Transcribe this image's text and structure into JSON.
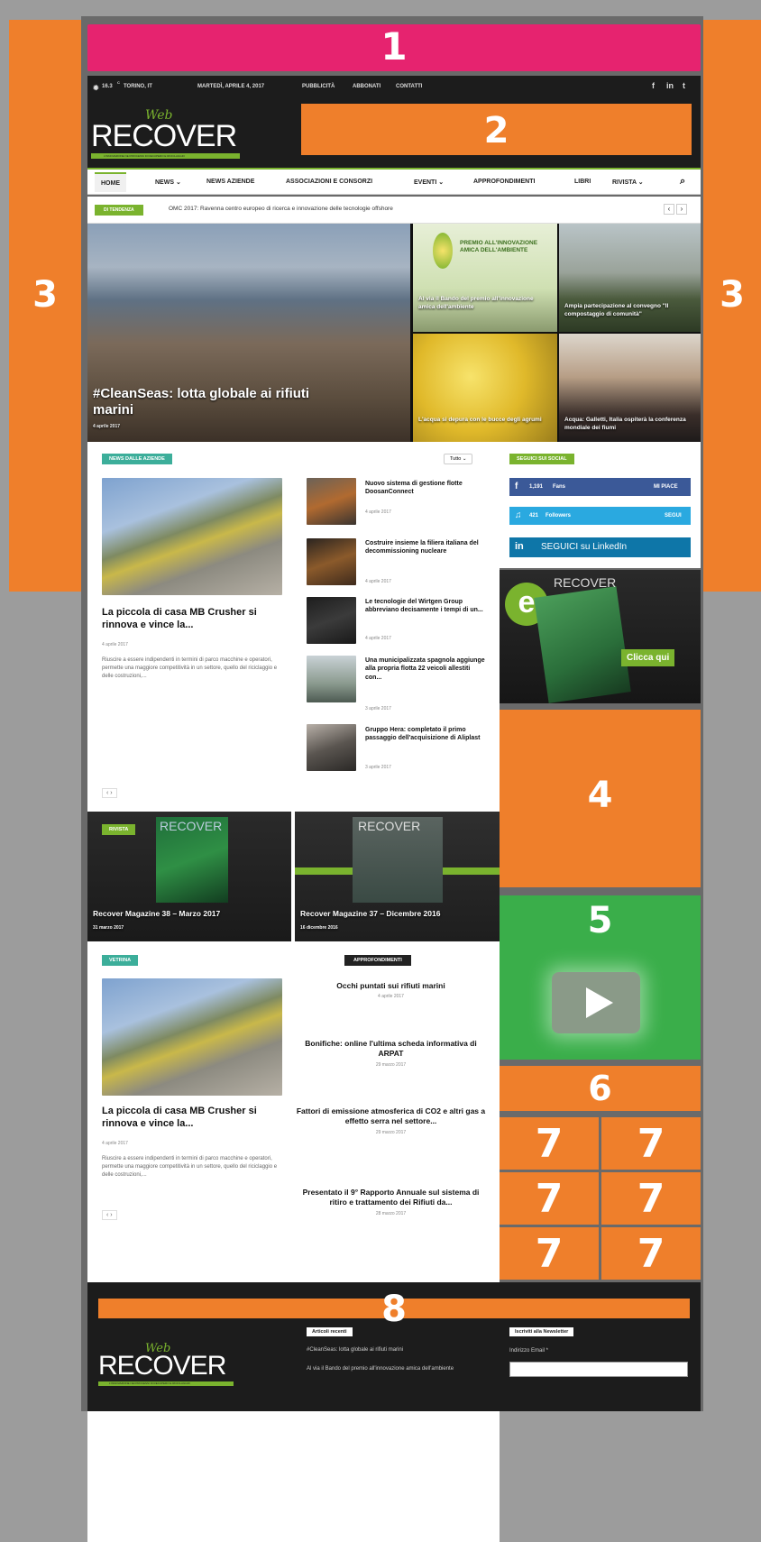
{
  "slots": {
    "1": "1",
    "2": "2",
    "3": "3",
    "4": "4",
    "5": "5",
    "6": "6",
    "7": "7",
    "8": "8"
  },
  "topbar": {
    "temp": "16.3",
    "temp_unit": "C",
    "city": "TORINO, IT",
    "date": "MARTEDÌ, APRILE 4, 2017",
    "links": [
      "PUBBLICITÀ",
      "ABBONATI",
      "CONTATTI"
    ],
    "social": [
      "f",
      "in",
      "t"
    ]
  },
  "logo": {
    "main": "RECOVER",
    "script": "Web",
    "tagline": "L'INNOVAZIONE NEI PROCESSI DI RECUPERO E RICICLAGGIO"
  },
  "nav": {
    "items": [
      "HOME",
      "NEWS ⌄",
      "NEWS AZIENDE",
      "ASSOCIAZIONI E CONSORZI",
      "EVENTI ⌄",
      "APPROFONDIMENTI",
      "LIBRI",
      "RIVISTA ⌄"
    ]
  },
  "ticker": {
    "label": "DI TENDENZA",
    "text": "OMC 2017: Ravenna centro europeo di ricerca e innovazione delle tecnologie offshore",
    "prev": "‹",
    "next": "›"
  },
  "hero": {
    "main_title": "#CleanSeas: lotta globale ai rifiuti marini",
    "main_date": "4 aprile 2017",
    "t1_title": "Al via il Bando del premio all'innovazione amica dell'ambiente",
    "t1_banner": "PREMIO ALL'INNOVAZIONE AMICA DELL'AMBIENTE",
    "t2_title": "Ampia partecipazione al convegno \"Il compostaggio di comunità\"",
    "t3_title": "L'acqua si depura con le bucce degli agrumi",
    "t4_title": "Acqua: Galletti, Italia ospiterà la conferenza mondiale dei fiumi"
  },
  "news": {
    "badge": "NEWS DALLE AZIENDE",
    "filter": "Tutto ⌄",
    "lead_title": "La piccola di casa MB Crusher si rinnova e vince la...",
    "lead_date": "4 aprile 2017",
    "lead_excerpt": "Riuscire a essere indipendenti in termini di parco macchine e operatori, permette una maggiore competitività in un settore, quello del riciclaggio e delle costruzioni,...",
    "list": [
      {
        "title": "Nuovo sistema di gestione flotte DoosanConnect",
        "date": "4 aprile 2017"
      },
      {
        "title": "Costruire insieme la filiera italiana del decommissioning nucleare",
        "date": "4 aprile 2017"
      },
      {
        "title": "Le tecnologie del Wirtgen Group abbreviano decisamente i tempi di un...",
        "date": "4 aprile 2017"
      },
      {
        "title": "Una municipalizzata spagnola aggiunge alla propria flotta 22 veicoli allestiti con...",
        "date": "3 aprile 2017"
      },
      {
        "title": "Gruppo Hera: completato il primo passaggio dell'acquisizione di Aliplast",
        "date": "3 aprile 2017"
      }
    ],
    "pager": "‹ ›"
  },
  "magazine": {
    "badge": "RIVISTA",
    "a_title": "Recover Magazine 38 – Marzo 2017",
    "a_date": "31 marzo 2017",
    "b_title": "Recover Magazine 37 – Dicembre 2016",
    "b_date": "16 dicembre 2016",
    "logo": "RECOVER"
  },
  "vetrina": {
    "badge": "VETRINA",
    "title": "La piccola di casa MB Crusher si rinnova e vince la...",
    "date": "4 aprile 2017",
    "excerpt": "Riuscire a essere indipendenti in termini di parco macchine e operatori, permette una maggiore competitività in un settore, quello del riciclaggio e delle costruzioni,...",
    "pager": "‹ ›"
  },
  "approfondimenti": {
    "badge": "APPROFONDIMENTI",
    "items": [
      {
        "title": "Occhi puntati sui rifiuti marini",
        "date": "4 aprile 2017"
      },
      {
        "title": "Bonifiche: online l'ultima scheda informativa di ARPAT",
        "date": "29 marzo 2017"
      },
      {
        "title": "Fattori di emissione atmosferica di CO2 e altri gas a effetto serra nel settore...",
        "date": "29 marzo 2017"
      },
      {
        "title": "Presentato il 9° Rapporto Annuale sul sistema di ritiro e trattamento dei Rifiuti da...",
        "date": "28 marzo 2017"
      }
    ]
  },
  "sidebar": {
    "badge": "SEGUICI SUI SOCIAL",
    "fb_count": "1,191",
    "fb_label": "Fans",
    "fb_action": "MI PIACE",
    "tw_count": "421",
    "tw_label": "Followers",
    "tw_action": "SEGUI",
    "li_label": "SEGUICI su LinkedIn",
    "ad_cta": "Clicca qui",
    "ad_logo": "RECOVER"
  },
  "footer": {
    "recent_label": "Articoli recenti",
    "recent": [
      "#CleanSeas: lotta globale ai rifiuti marini",
      "Al via il Bando del premio all'innovazione amica dell'ambiente"
    ],
    "newsletter_label": "Iscriviti alla Newsletter",
    "email_label": "Indirizzo Email *"
  },
  "colors": {
    "accent": "#7ab32e",
    "slot_orange": "#ef7f2b",
    "slot_pink": "#e6236f",
    "slot_green": "#3aae4a",
    "teal": "#3cae9a"
  }
}
